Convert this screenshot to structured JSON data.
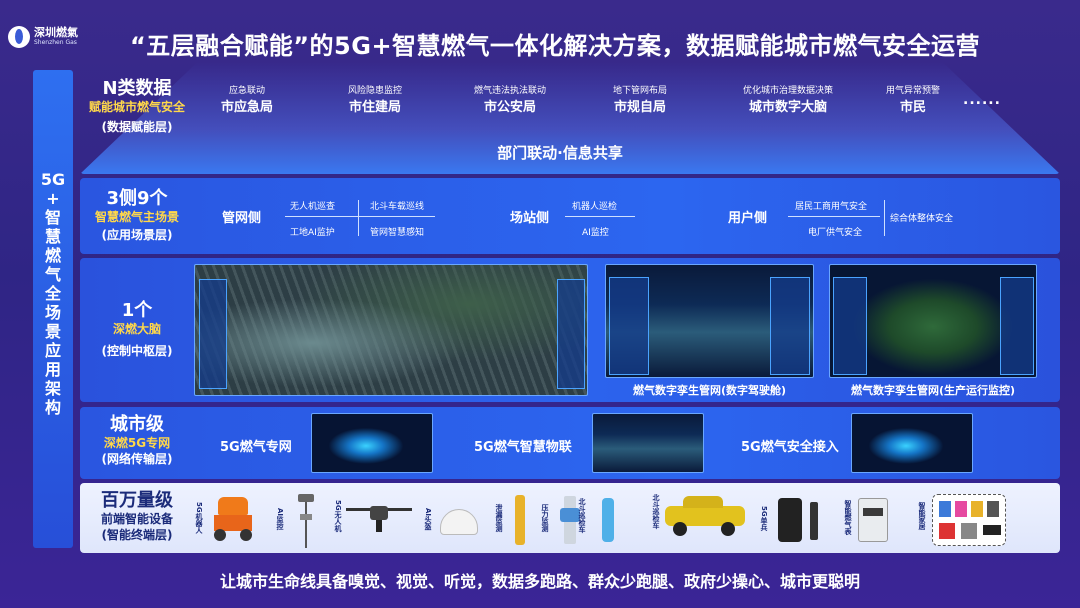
{
  "logo": {
    "cn": "深圳燃氣",
    "en": "Shenzhen Gas"
  },
  "title": "“五层融合赋能”的5G+智慧燃气一体化解决方案，数据赋能城市燃气安全运营",
  "side_label": [
    "5G",
    "+",
    "智",
    "慧",
    "燃",
    "气",
    "全",
    "场",
    "景",
    "应",
    "用",
    "架",
    "构"
  ],
  "layer1": {
    "big": "N类数据",
    "yellow": "赋能城市燃气安全",
    "sub": "(数据赋能层)",
    "depts": [
      {
        "task": "应急联动",
        "name": "市应急局"
      },
      {
        "task": "风险隐患监控",
        "name": "市住建局"
      },
      {
        "task": "燃气违法执法联动",
        "name": "市公安局"
      },
      {
        "task": "地下管网布局",
        "name": "市规自局"
      },
      {
        "task": "优化城市治理数据决策",
        "name": "城市数字大脑"
      },
      {
        "task": "用气异常预警",
        "name": "市民"
      }
    ],
    "dots": "......",
    "share": "部门联动·信息共享"
  },
  "layer2": {
    "big": "3侧9个",
    "yellow": "智慧燃气主场景",
    "sub": "(应用场景层)",
    "pipe": {
      "title": "管网侧",
      "items": [
        "无人机巡查",
        "北斗车载巡线",
        "工地AI监护",
        "管网智慧感知"
      ]
    },
    "station": {
      "title": "场站侧",
      "items": [
        "机器人巡检",
        "AI监控"
      ]
    },
    "user": {
      "title": "用户侧",
      "items": [
        "居民工商用气安全",
        "电厂供气安全",
        "综合体整体安全"
      ]
    }
  },
  "layer3": {
    "big": "1个",
    "yellow": "深燃大脑",
    "sub": "(控制中枢层)",
    "captions": [
      "燃气数字孪生管网(数字驾驶舱)",
      "燃气数字孪生管网(生产运行监控)"
    ]
  },
  "layer4": {
    "big": "城市级",
    "yellow": "深燃5G专网",
    "sub": "(网络传输层)",
    "nets": [
      "5G燃气专网",
      "5G燃气智慧物联",
      "5G燃气安全接入"
    ]
  },
  "layer5": {
    "big": "百万量级",
    "yellow": "前端智能设备",
    "sub": "(智能终端层)",
    "devices": [
      "5G机器人",
      "AI监控",
      "5G无人机",
      "AI头盔",
      "泄漏监测",
      "压力监测",
      "北斗巡检车",
      "5G单兵",
      "智能燃气表",
      "智能家居"
    ]
  },
  "footer": "让城市生命线具备嗅觉、视觉、听觉，数据多跑路、群众少跑腿、政府少操心、城市更聪明"
}
